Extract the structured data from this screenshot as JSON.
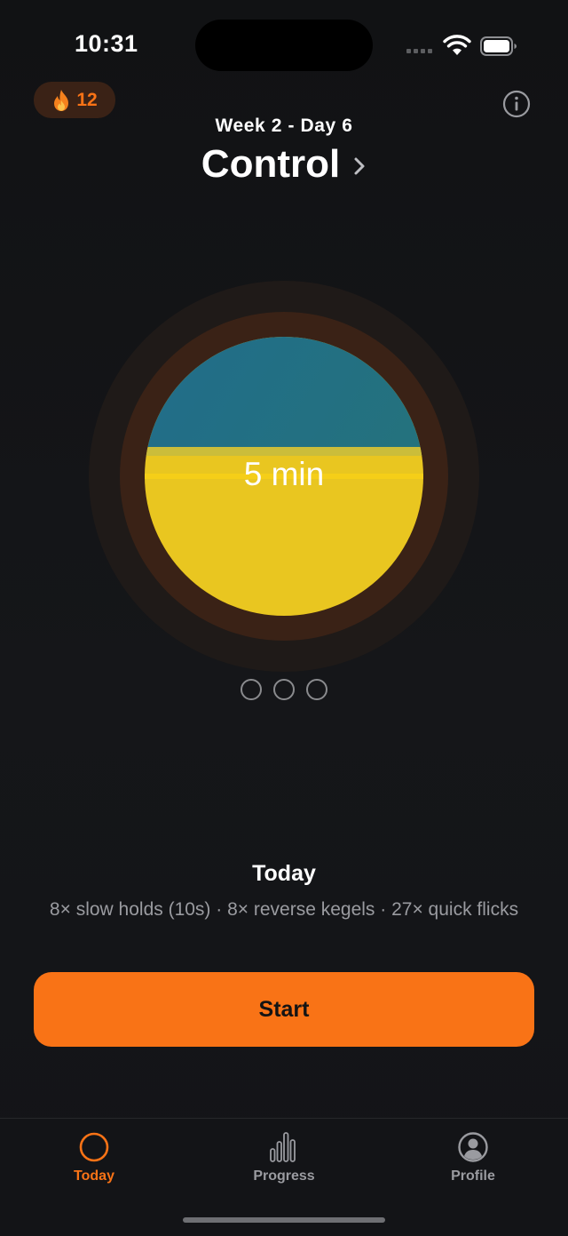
{
  "status_bar": {
    "time": "10:31"
  },
  "header": {
    "streak_count": "12",
    "week_day": "Week 2 - Day 6",
    "title": "Control"
  },
  "session": {
    "duration_label": "5 min",
    "progress_dots_total": 3,
    "progress_dots_completed": 0
  },
  "today": {
    "heading": "Today",
    "description": "8× slow holds (10s) · 8× reverse kegels · 27× quick flicks"
  },
  "actions": {
    "start_label": "Start"
  },
  "tabs": [
    {
      "label": "Today",
      "icon": "circle-icon",
      "active": true
    },
    {
      "label": "Progress",
      "icon": "bar-chart-icon",
      "active": false
    },
    {
      "label": "Profile",
      "icon": "person-circle-icon",
      "active": false
    }
  ],
  "colors": {
    "accent": "#f97316",
    "badge_bg": "#3a2216",
    "water_blue": "#216d8a",
    "fill_yellow": "#e9c620"
  }
}
